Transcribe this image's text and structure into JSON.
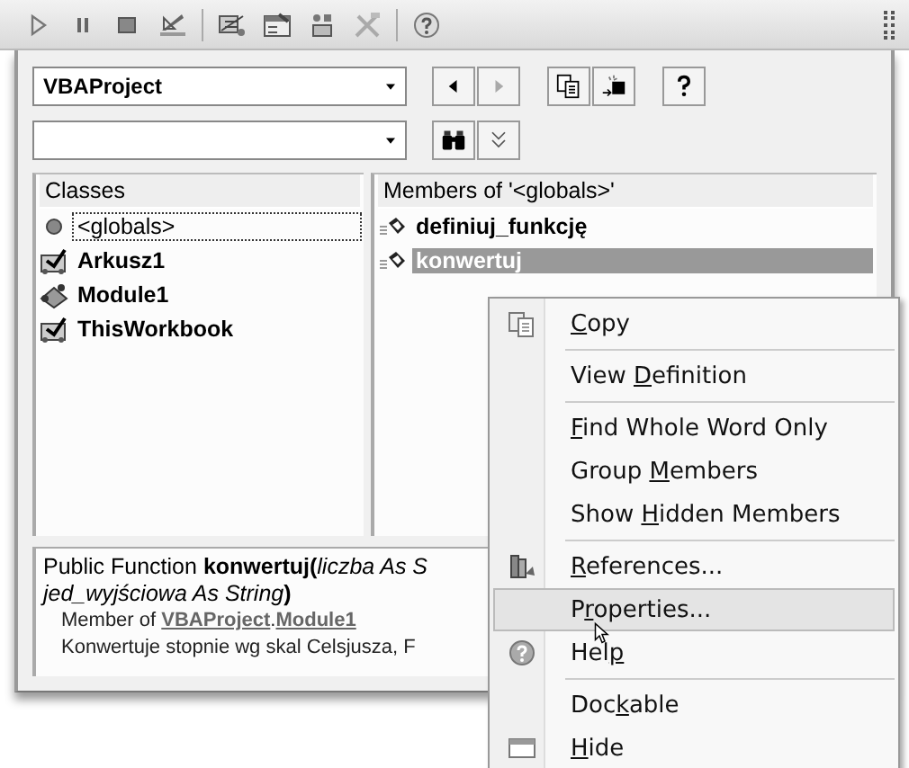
{
  "toolbar": {
    "buttons": [
      {
        "kind": "run"
      },
      {
        "kind": "pause"
      },
      {
        "kind": "stop"
      },
      {
        "kind": "design"
      },
      {
        "kind": "explorer"
      },
      {
        "kind": "properties"
      },
      {
        "kind": "browser"
      },
      {
        "kind": "toolbox"
      },
      {
        "kind": "help"
      }
    ]
  },
  "browser": {
    "project_combo": {
      "value": "VBAProject"
    },
    "nav_buttons": [
      {
        "kind": "back",
        "disabled": false
      },
      {
        "kind": "forward",
        "disabled": true
      },
      {
        "kind": "copy",
        "disabled": false
      },
      {
        "kind": "definition",
        "disabled": false
      },
      {
        "kind": "help",
        "disabled": false
      }
    ],
    "search_buttons": [
      {
        "kind": "search"
      },
      {
        "kind": "toggle"
      }
    ],
    "classes": {
      "header": "Classes",
      "items": [
        {
          "name": "<globals>",
          "kind": "globals",
          "has_code": false,
          "selected": true
        },
        {
          "name": "Arkusz1",
          "kind": "sheet",
          "has_code": true,
          "selected": false
        },
        {
          "name": "Module1",
          "kind": "module",
          "has_code": true,
          "selected": false
        },
        {
          "name": "ThisWorkbook",
          "kind": "sheet",
          "has_code": true,
          "selected": false
        }
      ]
    },
    "members": {
      "header": "Members of '<globals>'",
      "items": [
        {
          "name": "definiuj_funkcję",
          "has_code": true,
          "selected": false
        },
        {
          "name": "konwertuj",
          "has_code": true,
          "selected": true
        }
      ]
    },
    "details": {
      "lines": [
        {
          "kind": "text",
          "parts": [
            {
              "text": "Public Function ",
              "bold": false,
              "italic": false
            },
            {
              "text": "konwertuj(",
              "bold": true,
              "italic": false
            },
            {
              "text": "liczba As S",
              "bold": false,
              "italic": true
            }
          ]
        },
        {
          "kind": "text",
          "parts": [
            {
              "text": "jed_wyjściowa As String",
              "bold": false,
              "italic": true
            },
            {
              "text": ")",
              "bold": true,
              "italic": false
            }
          ]
        },
        {
          "kind": "member",
          "prefix": "Member of ",
          "links": [
            "VBAProject",
            "Module1"
          ],
          "joiner": "."
        },
        {
          "kind": "note",
          "text": "Konwertuje stopnie wg skal Celsjusza, F"
        }
      ]
    }
  },
  "context_menu": {
    "items": [
      {
        "key": "C",
        "post": "opy",
        "kind": "copy",
        "separator_before": false,
        "selected": false
      },
      {
        "pre": "View ",
        "key": "D",
        "post": "efinition",
        "kind": "plain",
        "separator_before": true,
        "selected": false
      },
      {
        "key": "F",
        "post": "ind Whole Word Only",
        "kind": "plain",
        "separator_before": true,
        "selected": false
      },
      {
        "pre": "Group ",
        "key": "M",
        "post": "embers",
        "kind": "plain",
        "separator_before": false,
        "selected": false
      },
      {
        "pre": "Show ",
        "key": "H",
        "post": "idden Members",
        "kind": "plain",
        "separator_before": false,
        "selected": false
      },
      {
        "key": "R",
        "post": "eferences...",
        "kind": "references",
        "separator_before": true,
        "selected": false
      },
      {
        "pre": "P",
        "key": "r",
        "post": "operties...",
        "kind": "plain",
        "separator_before": false,
        "selected": true
      },
      {
        "pre": "Hel",
        "key": "p",
        "kind": "help",
        "separator_before": false,
        "selected": false
      },
      {
        "pre": "Doc",
        "key": "k",
        "post": "able",
        "kind": "plain",
        "separator_before": true,
        "selected": false
      },
      {
        "key": "H",
        "post": "ide",
        "kind": "window",
        "separator_before": false,
        "selected": false
      }
    ]
  }
}
